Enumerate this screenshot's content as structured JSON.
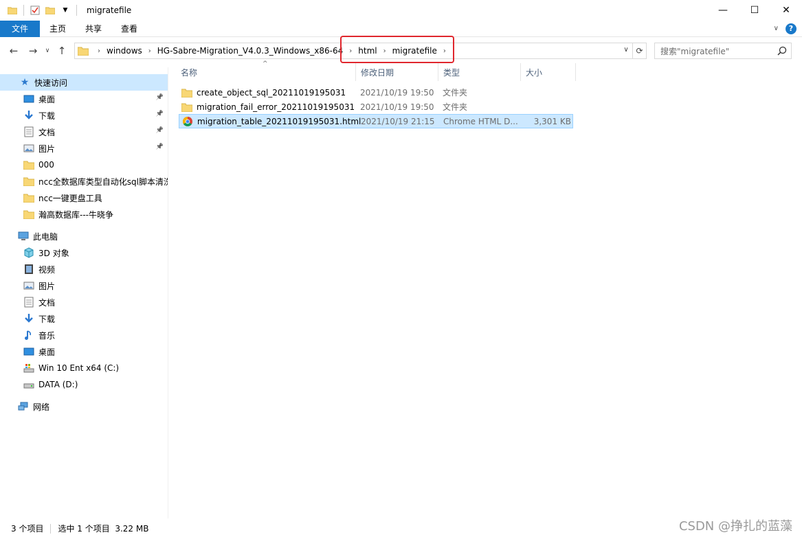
{
  "window": {
    "title": "migratefile"
  },
  "controls": {
    "minimize": "—",
    "maximize": "☐",
    "close": "✕"
  },
  "ribbon": {
    "tabs": [
      "文件",
      "主页",
      "共享",
      "查看"
    ]
  },
  "address": {
    "crumbs": [
      "windows",
      "HG-Sabre-Migration_V4.0.3_Windows_x86-64",
      "html",
      "migratefile"
    ],
    "search_placeholder": "搜索\"migratefile\""
  },
  "sidebar": {
    "quick_access": {
      "label": "快速访问"
    },
    "quick_items": [
      {
        "label": "桌面",
        "icon": "desktop-icon",
        "pinned": true
      },
      {
        "label": "下载",
        "icon": "download-icon",
        "pinned": true
      },
      {
        "label": "文档",
        "icon": "document-icon",
        "pinned": true
      },
      {
        "label": "图片",
        "icon": "picture-icon",
        "pinned": true
      },
      {
        "label": "000",
        "icon": "folder-icon",
        "pinned": false
      },
      {
        "label": "ncc全数据库类型自动化sql脚本清洗",
        "icon": "folder-icon",
        "pinned": false
      },
      {
        "label": "ncc一键更盘工具",
        "icon": "folder-icon",
        "pinned": false
      },
      {
        "label": "瀚高数据库---牛晓争",
        "icon": "folder-icon",
        "pinned": false
      }
    ],
    "this_pc": {
      "label": "此电脑"
    },
    "pc_items": [
      {
        "label": "3D 对象",
        "icon": "3d-objects-icon"
      },
      {
        "label": "视频",
        "icon": "video-icon"
      },
      {
        "label": "图片",
        "icon": "picture-icon"
      },
      {
        "label": "文档",
        "icon": "document-icon"
      },
      {
        "label": "下载",
        "icon": "download-icon"
      },
      {
        "label": "音乐",
        "icon": "music-icon"
      },
      {
        "label": "桌面",
        "icon": "desktop-icon"
      },
      {
        "label": "Win 10 Ent x64 (C:)",
        "icon": "drive-c-icon"
      },
      {
        "label": "DATA (D:)",
        "icon": "drive-icon"
      }
    ],
    "network": {
      "label": "网络"
    }
  },
  "columns": {
    "name": "名称",
    "date": "修改日期",
    "type": "类型",
    "size": "大小"
  },
  "files": [
    {
      "name": "create_object_sql_20211019195031",
      "date": "2021/10/19 19:50",
      "type": "文件夹",
      "size": "",
      "icon": "folder-icon"
    },
    {
      "name": "migration_fail_error_20211019195031",
      "date": "2021/10/19 19:50",
      "type": "文件夹",
      "size": "",
      "icon": "folder-icon"
    },
    {
      "name": "migration_table_20211019195031.html",
      "date": "2021/10/19 21:15",
      "type": "Chrome HTML D...",
      "size": "3,301 KB",
      "icon": "chrome-icon"
    }
  ],
  "status": {
    "count": "3 个项目",
    "selected": "选中 1 个项目  3.22 MB"
  },
  "watermark": "CSDN @挣扎的蓝藻",
  "colors": {
    "accent": "#1979ca",
    "selection": "#cce8ff",
    "highlight": "#e0262d"
  }
}
